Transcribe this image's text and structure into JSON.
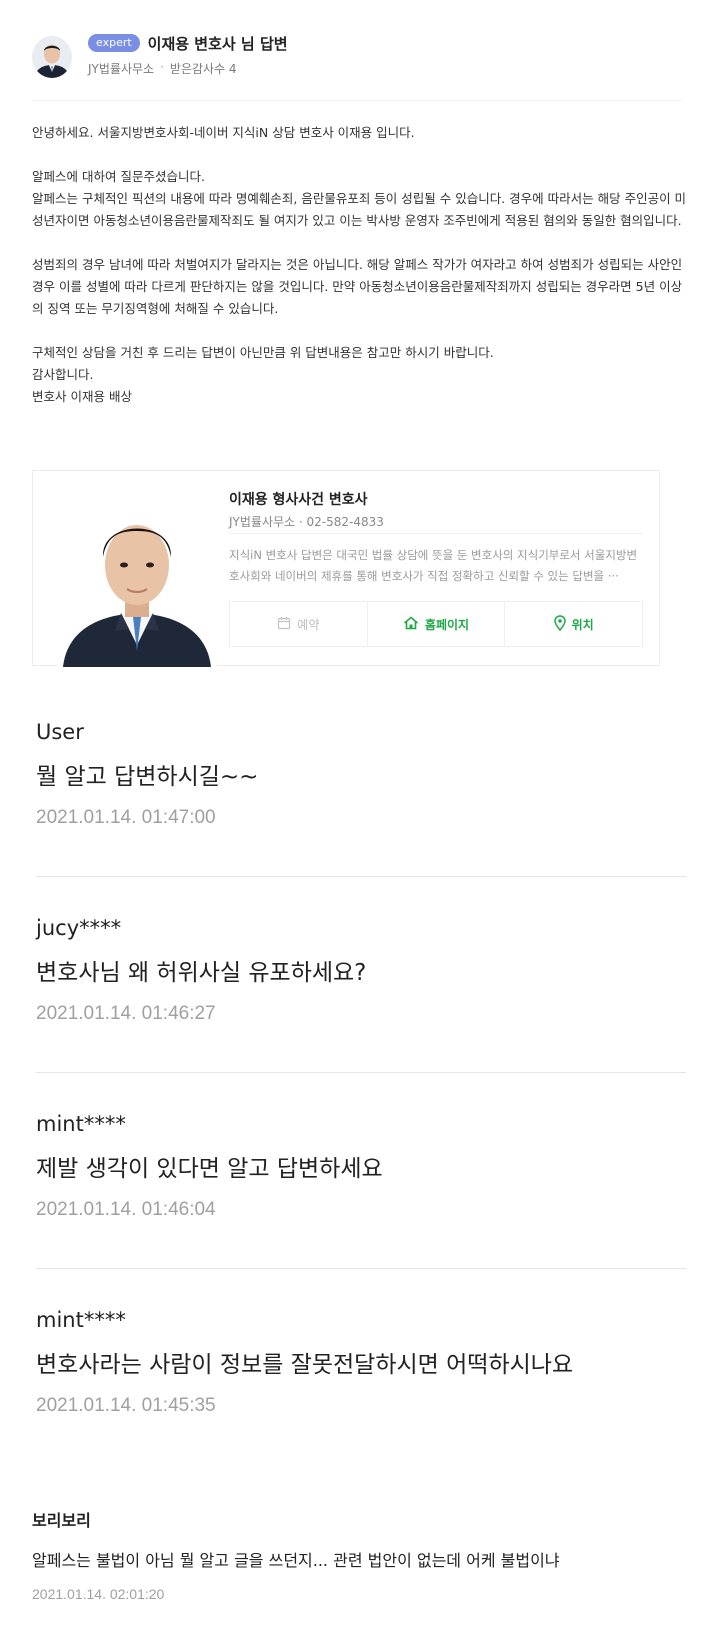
{
  "answer": {
    "badge": "expert",
    "author_title": "이재용 변호사 님 답변",
    "firm": "JY법률사무소",
    "thanks_count": "받은감사수 4"
  },
  "body": {
    "p1": "안녕하세요. 서울지방변호사회-네이버 지식iN 상담 변호사 이재용 입니다.",
    "p2": "알페스에 대하여 질문주셨습니다.\n알페스는 구체적인 픽션의 내용에 따라 명예훼손죄, 음란물유포죄 등이 성립될 수 있습니다. 경우에 따라서는 해당 주인공이 미성년자이면 아동청소년이용음란물제작죄도 될 여지가 있고 이는 박사방 운영자 조주빈에게 적용된 혐의와 동일한 혐의입니다.",
    "p3": "성범죄의 경우 남녀에 따라 처벌여지가 달라지는 것은 아닙니다. 해당 알페스 작가가 여자라고 하여 성범죄가 성립되는 사안인 경우 이를 성별에 따라 다르게 판단하지는 않을 것입니다. 만약 아동청소년이용음란물제작죄까지 성립되는 경우라면 5년 이상의 징역 또는 무기징역형에 처해질 수 있습니다.",
    "p4": "구체적인 상담을 거친 후 드리는 답변이 아닌만큼 위 답변내용은 참고만 하시기 바랍니다.",
    "p5": "감사합니다.",
    "p6": "변호사 이재용 배상"
  },
  "card": {
    "name": "이재용 형사사건 변호사",
    "sub": "JY법률사무소 · 02-582-4833",
    "desc": "지식iN 변호사 답변은 대국민 법률 상담에 뜻을 둔 변호사의 지식기부로서 서울지방변호사회와 네이버의 제휴를 통해 변호사가 직접 정확하고 신뢰할 수 있는 답변을 ···",
    "action_reserve": "예약",
    "action_home": "홈페이지",
    "action_location": "위치"
  },
  "comments": [
    {
      "user": "User",
      "text": "뭘 알고 답변하시길~~",
      "date": "2021.01.14. 01:47:00"
    },
    {
      "user": "jucy****",
      "text": "변호사님 왜 허위사실 유포하세요?",
      "date": "2021.01.14. 01:46:27"
    },
    {
      "user": "mint****",
      "text": "제발 생각이 있다면 알고 답변하세요",
      "date": "2021.01.14. 01:46:04"
    },
    {
      "user": "mint****",
      "text": "변호사라는 사람이 정보를 잘못전달하시면 어떡하시나요",
      "date": "2021.01.14. 01:45:35"
    }
  ],
  "last_comment": {
    "user": "보리보리",
    "text": "알페스는 불법이 아님 뭘 알고 글을 쓰던지... 관련 법안이 없는데 어케 불법이냐",
    "date": "2021.01.14. 02:01:20"
  },
  "colors": {
    "badge": "#7a8ee6",
    "action_green": "#1ea946",
    "muted": "#a0a0a0"
  }
}
